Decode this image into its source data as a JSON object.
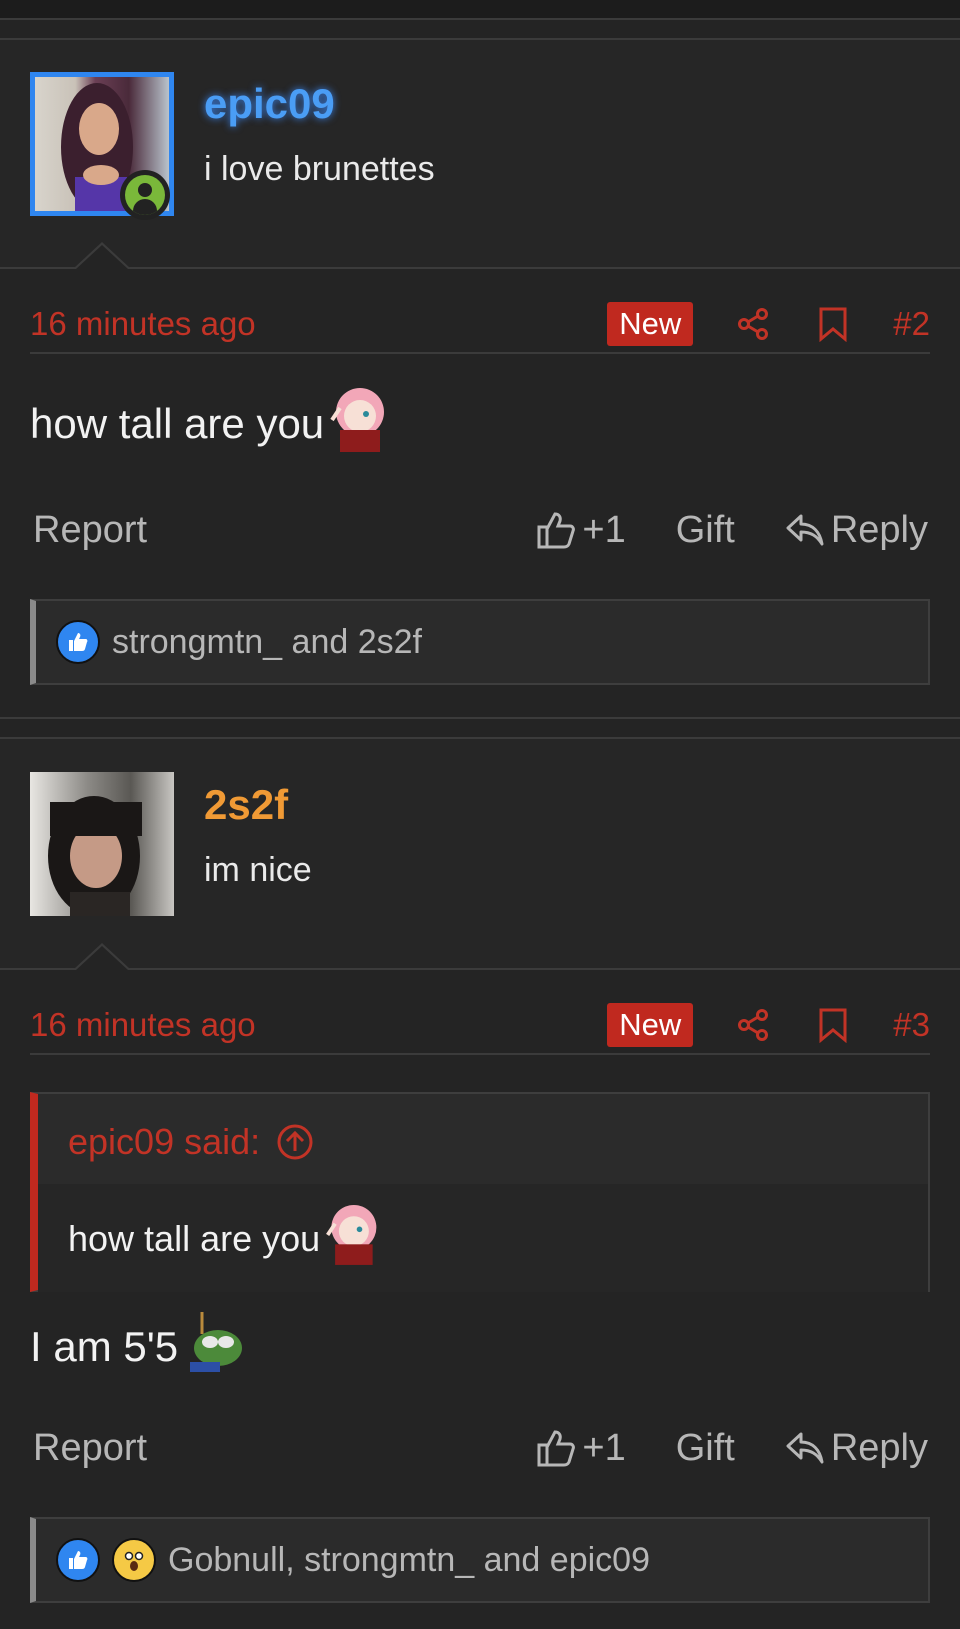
{
  "posts": [
    {
      "username": "epic09",
      "user_title": "i love brunettes",
      "time": "16 minutes ago",
      "badge": "New",
      "number": "#2",
      "message": "how tall are you",
      "actions": {
        "report": "Report",
        "like": "+1",
        "gift": "Gift",
        "reply": "Reply"
      },
      "reactions_text": "strongmtn_ and 2s2f",
      "username_color": "#4a9df5"
    },
    {
      "username": "2s2f",
      "user_title": "im nice",
      "time": "16 minutes ago",
      "badge": "New",
      "number": "#3",
      "quote": {
        "author": "epic09 said:",
        "text": "how tall are you"
      },
      "message": "I am 5'5",
      "actions": {
        "report": "Report",
        "like": "+1",
        "gift": "Gift",
        "reply": "Reply"
      },
      "reactions_text": "Gobnull, strongmtn_ and epic09",
      "username_color": "#f09a35"
    }
  ],
  "colors": {
    "accent": "#c0291f",
    "background": "#242424",
    "online": "#7ab83a",
    "like": "#2f86f0"
  }
}
